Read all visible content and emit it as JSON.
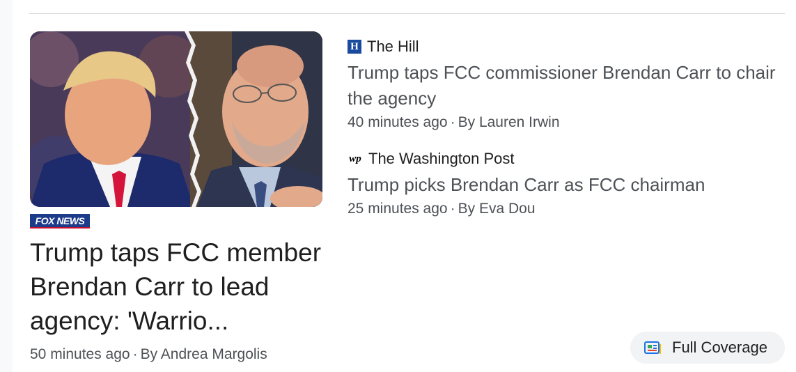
{
  "featured": {
    "source_logo_text": "FOX NEWS",
    "title": "Trump taps FCC member Brendan Carr to lead agency: 'Warrio...",
    "time": "50 minutes ago",
    "author": "By Andrea Margolis"
  },
  "stories": [
    {
      "source": "The Hill",
      "source_icon": "hill-logo-icon",
      "title": "Trump taps FCC commissioner Brendan Carr to chair the agency",
      "time": "40 minutes ago",
      "author": "By Lauren Irwin"
    },
    {
      "source": "The Washington Post",
      "source_icon": "wapo-logo-icon",
      "title": "Trump picks Brendan Carr as FCC chairman",
      "time": "25 minutes ago",
      "author": "By Eva Dou"
    }
  ],
  "full_coverage": {
    "label": "Full Coverage",
    "icon": "full-coverage-icon"
  },
  "colors": {
    "hill_blue": "#1a4a9e",
    "fox_blue": "#1d3b8b",
    "meta_gray": "#4d5156",
    "chip_bg": "#f1f3f4"
  }
}
